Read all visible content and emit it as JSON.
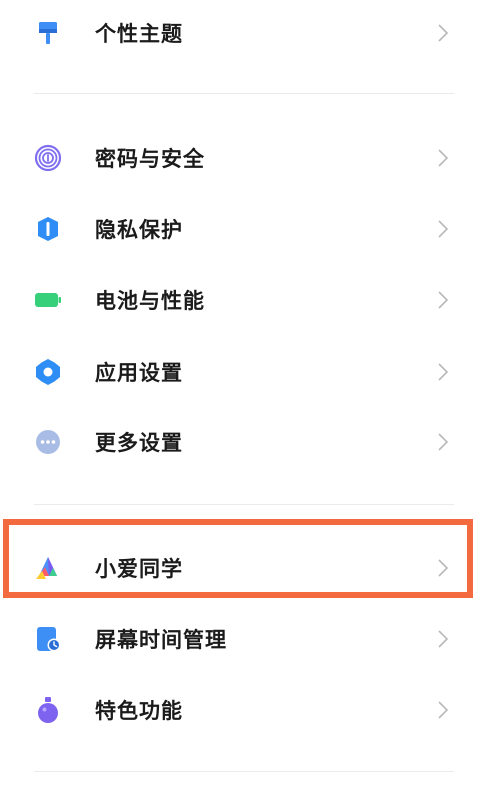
{
  "settings": {
    "items": [
      {
        "id": "theme",
        "label": "个性主题",
        "icon": "paintbrush-icon",
        "color": "#3d8ff5"
      },
      {
        "id": "password",
        "label": "密码与安全",
        "icon": "fingerprint-icon",
        "color": "#7f6ff0"
      },
      {
        "id": "privacy",
        "label": "隐私保护",
        "icon": "shield-icon",
        "color": "#2f8ef5"
      },
      {
        "id": "battery",
        "label": "电池与性能",
        "icon": "battery-icon",
        "color": "#36d07a"
      },
      {
        "id": "apps",
        "label": "应用设置",
        "icon": "gear-icon",
        "color": "#2f8ef5"
      },
      {
        "id": "more",
        "label": "更多设置",
        "icon": "more-dots-icon",
        "color": "#9fb3df"
      },
      {
        "id": "xiaoai",
        "label": "小爱同学",
        "icon": "xiaoai-icon",
        "color": "#4c8ff6"
      },
      {
        "id": "screentime",
        "label": "屏幕时间管理",
        "icon": "screen-time-icon",
        "color": "#3d8ff5"
      },
      {
        "id": "features",
        "label": "特色功能",
        "icon": "flask-icon",
        "color": "#7e63f0"
      }
    ]
  },
  "highlight": {
    "color": "#f26a3d",
    "target": "xiaoai"
  }
}
